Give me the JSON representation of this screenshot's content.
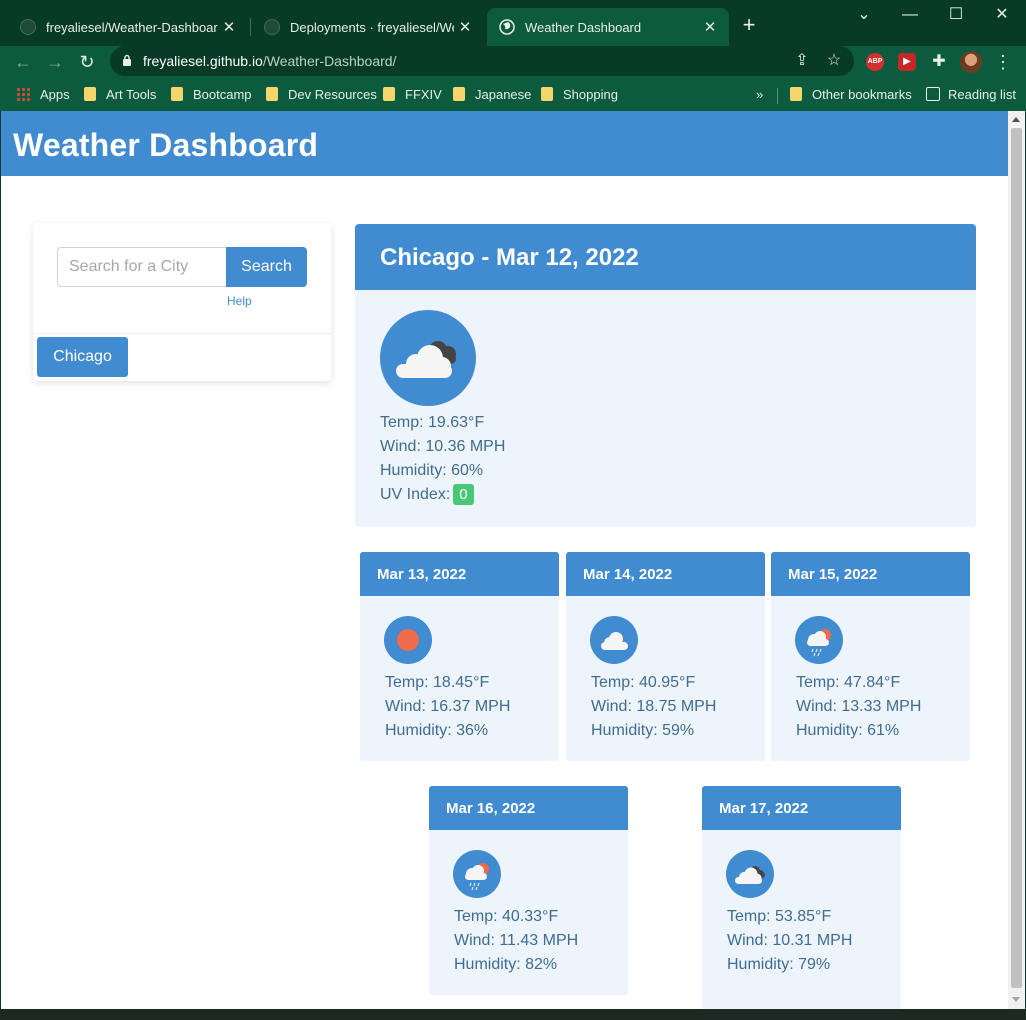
{
  "browser": {
    "tabs": [
      {
        "title": "freyaliesel/Weather-Dashboard"
      },
      {
        "title": "Deployments · freyaliesel/Weathe"
      },
      {
        "title": "Weather Dashboard"
      }
    ],
    "url_host": "freyaliesel.github.io",
    "url_path": "/Weather-Dashboard/",
    "bookmarks": [
      "Apps",
      "Art Tools",
      "Bootcamp",
      "Dev Resources",
      "FFXIV",
      "Japanese",
      "Shopping"
    ],
    "bookmarks_overflow": "»",
    "other_bookmarks": "Other bookmarks",
    "reading_list": "Reading list",
    "ext_abp": "ABP"
  },
  "site": {
    "title": "Weather Dashboard"
  },
  "search": {
    "placeholder": "Search for a City",
    "button_label": "Search",
    "help_label": "Help",
    "history": [
      "Chicago"
    ]
  },
  "current": {
    "heading": "Chicago - Mar 12, 2022",
    "icon": "cloudy-icon",
    "temp": "Temp: 19.63°F",
    "wind": "Wind: 10.36 MPH",
    "humidity": "Humidity: 60%",
    "uv_label": "UV Index:",
    "uv_value": "0",
    "uv_color": "#48c774"
  },
  "forecast": [
    {
      "date": "Mar 13, 2022",
      "icon": "sun-icon",
      "temp": "Temp: 18.45°F",
      "wind": "Wind: 16.37 MPH",
      "humidity": "Humidity: 36%"
    },
    {
      "date": "Mar 14, 2022",
      "icon": "cloud-icon",
      "temp": "Temp: 40.95°F",
      "wind": "Wind: 18.75 MPH",
      "humidity": "Humidity: 59%"
    },
    {
      "date": "Mar 15, 2022",
      "icon": "sun-rain-icon",
      "temp": "Temp: 47.84°F",
      "wind": "Wind: 13.33 MPH",
      "humidity": "Humidity: 61%"
    },
    {
      "date": "Mar 16, 2022",
      "icon": "sun-rain-icon",
      "temp": "Temp: 40.33°F",
      "wind": "Wind: 11.43 MPH",
      "humidity": "Humidity: 82%"
    },
    {
      "date": "Mar 17, 2022",
      "icon": "cloudy-icon",
      "temp": "Temp: 53.85°F",
      "wind": "Wind: 10.31 MPH",
      "humidity": "Humidity: 79%"
    }
  ],
  "colors": {
    "accent": "#418bd1",
    "card_bg": "#eef4fb",
    "stat_text": "#3f6c91",
    "chrome_green": "#0c5b3e"
  }
}
